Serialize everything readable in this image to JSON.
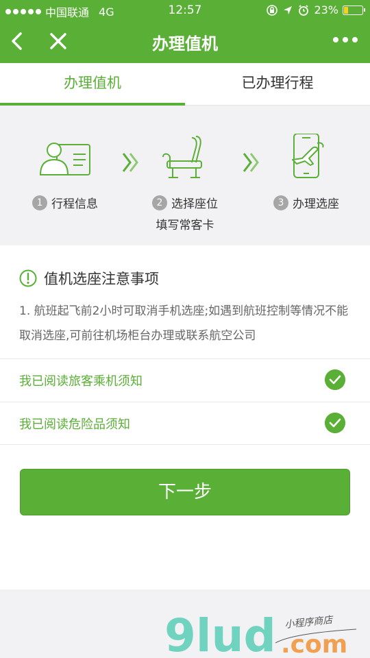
{
  "status_bar": {
    "carrier": "中国联通",
    "network": "4G",
    "time": "12:57",
    "battery": "23%",
    "battery_level": 0.23
  },
  "nav": {
    "title": "办理值机"
  },
  "tabs": [
    {
      "label": "办理值机",
      "active": true
    },
    {
      "label": "已办理行程",
      "active": false
    }
  ],
  "steps": [
    {
      "num": "1",
      "label": "行程信息",
      "sub": "",
      "icon": "id-card-icon"
    },
    {
      "num": "2",
      "label": "选择座位",
      "sub": "填写常客卡",
      "icon": "seat-icon"
    },
    {
      "num": "3",
      "label": "办理选座",
      "sub": "",
      "icon": "phone-plane-icon"
    }
  ],
  "notice": {
    "title": "值机选座注意事项",
    "text": "1. 航班起飞前2小时可取消手机选座;如遇到航班控制等情况不能取消选座,可前往机场柜台办理或联系航空公司"
  },
  "checks": [
    {
      "label": "我已阅读旅客乘机须知",
      "checked": true
    },
    {
      "label": "我已阅读危险品须知",
      "checked": true
    }
  ],
  "next_button": "下一步",
  "watermark": {
    "brand": "9lud",
    "domain": ".com",
    "tagline": "小程序商店"
  },
  "colors": {
    "accent": "#5aaf36",
    "step_number": "#a6a6a6",
    "battery_fill": "#f5d21f"
  }
}
